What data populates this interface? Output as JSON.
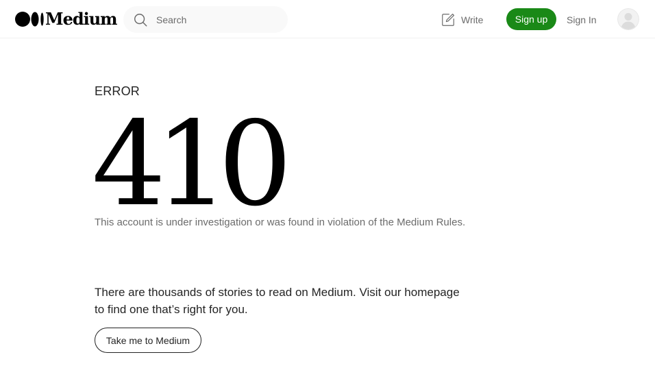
{
  "header": {
    "logo_text": "Medium",
    "search": {
      "placeholder": "Search",
      "value": ""
    },
    "write_label": "Write",
    "signup_label": "Sign up",
    "signin_label": "Sign In"
  },
  "main": {
    "error_label": "ERROR",
    "error_code": "410",
    "error_message": "This account is under investigation or was found in violation of the Medium Rules.",
    "promo_line1": "There are thousands of stories to read on Medium. Visit our homepage",
    "promo_line2": "to find one that’s right for you.",
    "home_button_label": "Take me to Medium"
  },
  "icons": {
    "logo": "medium-logo-icon",
    "search": "search-icon",
    "write": "write-icon",
    "avatar": "avatar-icon"
  },
  "colors": {
    "brand_green": "#1a8917",
    "text_primary": "#242424",
    "text_secondary": "#6b6b6b",
    "search_bg": "#f9f9f9"
  }
}
